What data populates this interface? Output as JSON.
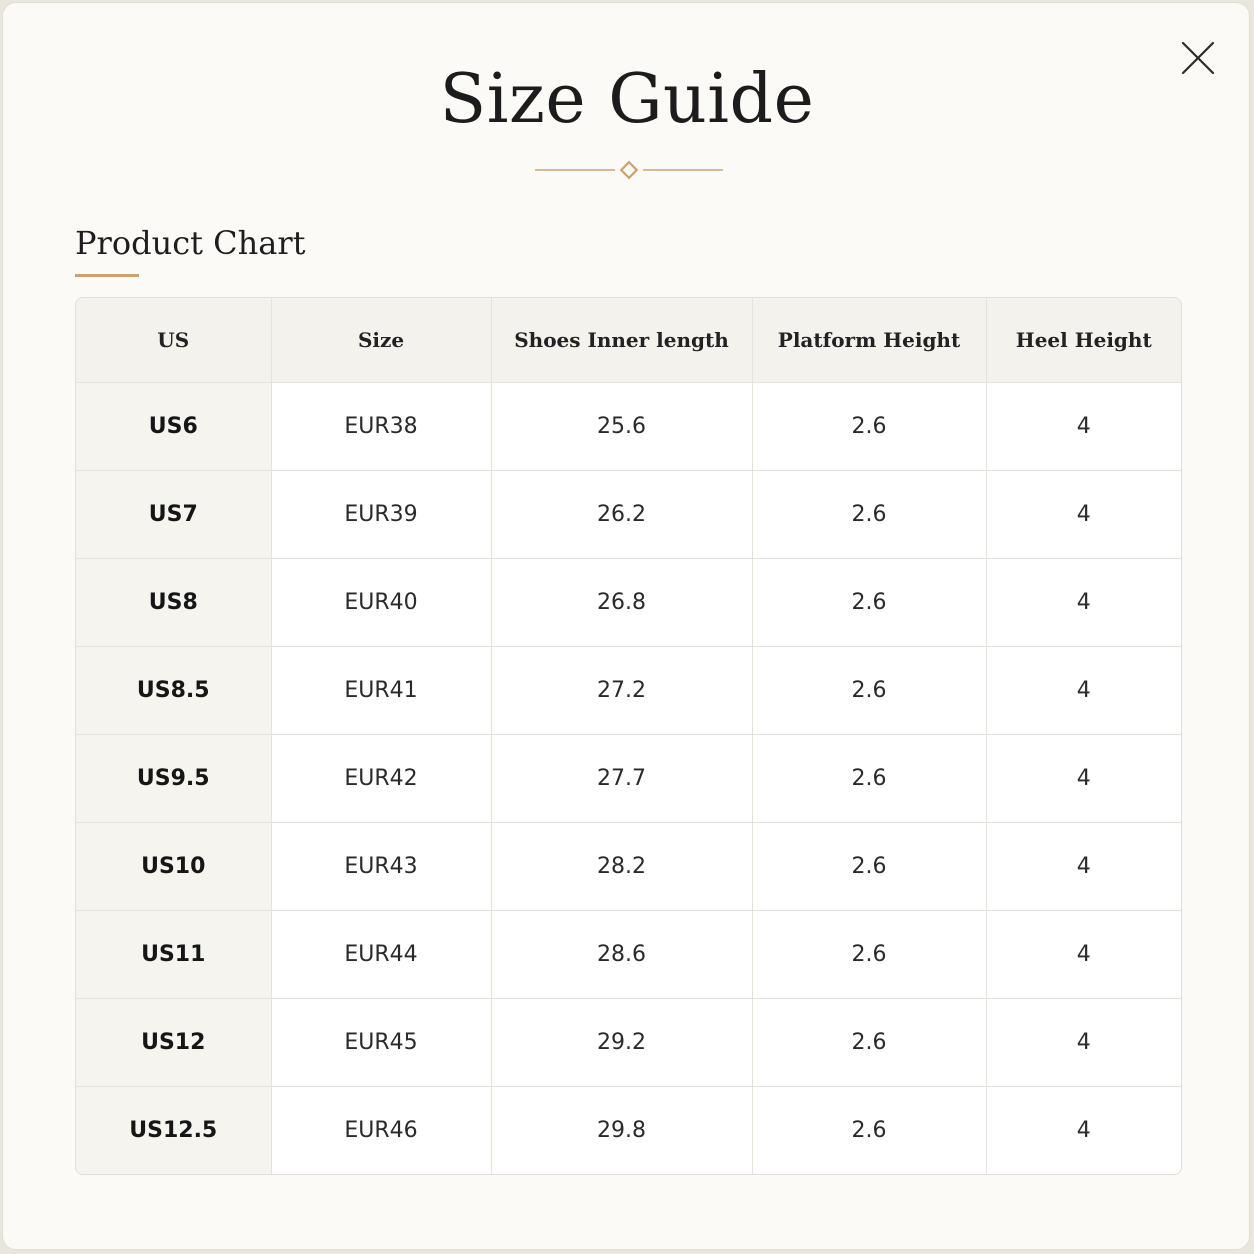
{
  "modal": {
    "title": "Size Guide",
    "section_title": "Product Chart",
    "accent_color": "#c9a46e"
  },
  "table": {
    "columns": [
      "US",
      "Size",
      "Shoes Inner length",
      "Platform Height",
      "Heel Height"
    ],
    "rows": [
      [
        "US6",
        "EUR38",
        "25.6",
        "2.6",
        "4"
      ],
      [
        "US7",
        "EUR39",
        "26.2",
        "2.6",
        "4"
      ],
      [
        "US8",
        "EUR40",
        "26.8",
        "2.6",
        "4"
      ],
      [
        "US8.5",
        "EUR41",
        "27.2",
        "2.6",
        "4"
      ],
      [
        "US9.5",
        "EUR42",
        "27.7",
        "2.6",
        "4"
      ],
      [
        "US10",
        "EUR43",
        "28.2",
        "2.6",
        "4"
      ],
      [
        "US11",
        "EUR44",
        "28.6",
        "2.6",
        "4"
      ],
      [
        "US12",
        "EUR45",
        "29.2",
        "2.6",
        "4"
      ],
      [
        "US12.5",
        "EUR46",
        "29.8",
        "2.6",
        "4"
      ]
    ]
  },
  "icons": {
    "close": "close-icon",
    "divider": "diamond-divider-icon"
  }
}
